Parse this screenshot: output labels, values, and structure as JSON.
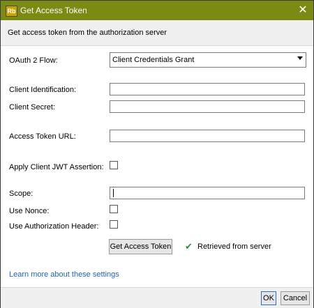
{
  "window": {
    "title": "Get Access Token",
    "app_icon_text": "Rb",
    "close_glyph": "✕"
  },
  "header": {
    "text": "Get access token from the authorization server"
  },
  "form": {
    "oauth_flow": {
      "label": "OAuth 2 Flow:",
      "selected": "Client Credentials Grant"
    },
    "client_id": {
      "label": "Client Identification:",
      "value": ""
    },
    "client_secret": {
      "label": "Client Secret:",
      "value": ""
    },
    "access_token_url": {
      "label": "Access Token URL:",
      "value": ""
    },
    "apply_jwt": {
      "label": "Apply Client JWT Assertion:",
      "checked": false
    },
    "scope": {
      "label": "Scope:",
      "value": ""
    },
    "use_nonce": {
      "label": "Use Nonce:",
      "checked": false
    },
    "use_auth_header": {
      "label": "Use Authorization Header:",
      "checked": false
    }
  },
  "actions": {
    "get_token_label": "Get Access Token",
    "status_text": "Retrieved from server",
    "learn_more": "Learn more about these settings"
  },
  "footer": {
    "ok_label": "OK",
    "cancel_label": "Cancel"
  },
  "colors": {
    "titlebar": "#7a8a13",
    "link": "#1f63b5",
    "check": "#2f8f2f"
  }
}
